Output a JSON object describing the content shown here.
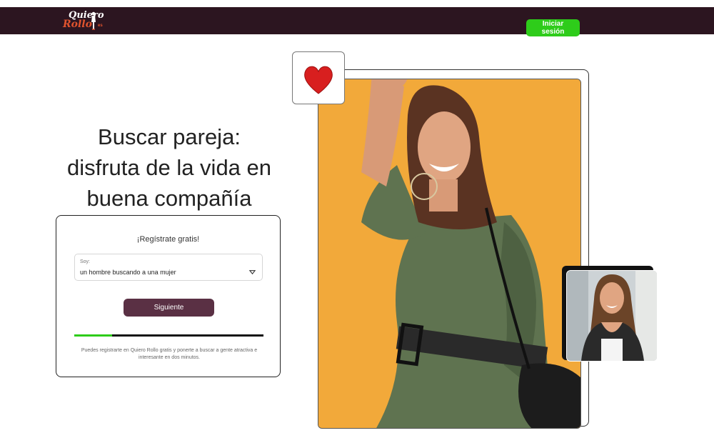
{
  "header": {
    "logo": {
      "line1": "Quiero",
      "line2": "Rollo",
      "suffix": "es"
    },
    "login_label": "Iniciar sesión"
  },
  "hero": {
    "headline_1": "Buscar pareja:",
    "headline_2": "disfruta de la vida en",
    "headline_3": "buena compañía"
  },
  "register": {
    "title": "¡Regístrate gratis!",
    "select_label": "Soy:",
    "select_value": "un hombre buscando a una mujer",
    "next_label": "Siguiente",
    "progress": 0.2,
    "footer_text": "Puedes registrarte en Quiero Rollo gratis y ponerte a buscar a gente atractiva e interesante en dos minutos."
  },
  "colors": {
    "header_bg": "#2c1520",
    "login_green": "#2ecc1a",
    "next_button": "#5a3044",
    "photo_bg": "#f2a93a",
    "heart": "#d81f1f"
  },
  "icons": {
    "heart": "heart-icon",
    "caret": "caret-down-icon"
  }
}
